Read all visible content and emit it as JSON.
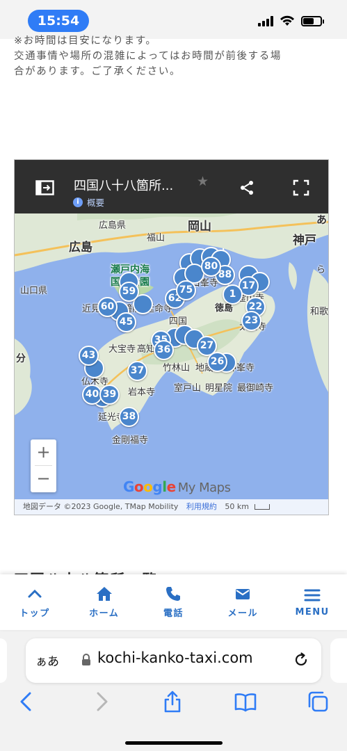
{
  "status_bar": {
    "time": "15:54"
  },
  "note": {
    "line0": "※お時間は目安になります。",
    "line1": "交通事情や場所の混雑によってはお時間が前後する場",
    "line2": "合があります。ご了承ください。"
  },
  "map": {
    "title": "四国八十八箇所...",
    "info_label": "概要",
    "labels": {
      "hiroshima_pref": "広島県",
      "hiroshima": "広島",
      "okayama": "岡山",
      "fukuyama": "福山",
      "kobe": "神戸",
      "setonaikai1": "瀬戸内海",
      "setonaikai2": "国立公園",
      "yamaguchi": "山口県",
      "hakuhoji": "白峯寺",
      "reizanji": "霊山寺",
      "tokushima": "徳島",
      "wakayama": "和歌",
      "tairyuji": "太龍寺",
      "chikamiyama": "近見山",
      "hoshoin": "宝鐘院",
      "enmeiji": "延命寺",
      "shikoku": "四国",
      "daihoji": "大宝寺",
      "taka": "高知",
      "chikurinzan": "竹林山",
      "jizoin": "地蔵院",
      "shinpoji": "神峯寺",
      "oita": "分",
      "butsumokuji": "仏木寺",
      "iwamotoji": "岩本寺",
      "murotozan": "室戸山",
      "meiseiin": "明星院",
      "hotsumisakiji": "最御崎寺",
      "enkoji": "延光寺",
      "kongofukuji": "金剛福寺",
      "kanji_a": "あ",
      "kanji_rin": "ら"
    },
    "markers": [
      "88",
      "17",
      "1",
      "22",
      "23",
      "59",
      "60",
      "45",
      "35",
      "36",
      "27",
      "26",
      "43",
      "37",
      "40",
      "39",
      "38",
      "62",
      "80",
      "75"
    ],
    "zoom_in": "+",
    "zoom_out": "−",
    "logo": {
      "g1": "G",
      "o1": "o",
      "o2": "o",
      "g2": "g",
      "l": "l",
      "e": "e",
      "mymaps": "My Maps"
    },
    "attribution": "地図データ ©2023 Google, TMap Mobility",
    "terms": "利用規約",
    "scale": "50 km"
  },
  "heading_peek": "四国八十八箇所一覧",
  "bottom_nav": [
    {
      "label": "トップ",
      "icon": "chevron-up-icon"
    },
    {
      "label": "ホーム",
      "icon": "home-icon"
    },
    {
      "label": "電話",
      "icon": "phone-icon"
    },
    {
      "label": "メール",
      "icon": "mail-icon"
    },
    {
      "label": "MENU",
      "icon": "menu-icon"
    }
  ],
  "safari": {
    "aa": "ぁあ",
    "url": "kochi-kanko-taxi.com"
  },
  "colors": {
    "accent": "#2a6fc4",
    "marker": "#4a86cc",
    "time_pill": "#2f7cf6",
    "map_header": "#2f2f2f"
  }
}
